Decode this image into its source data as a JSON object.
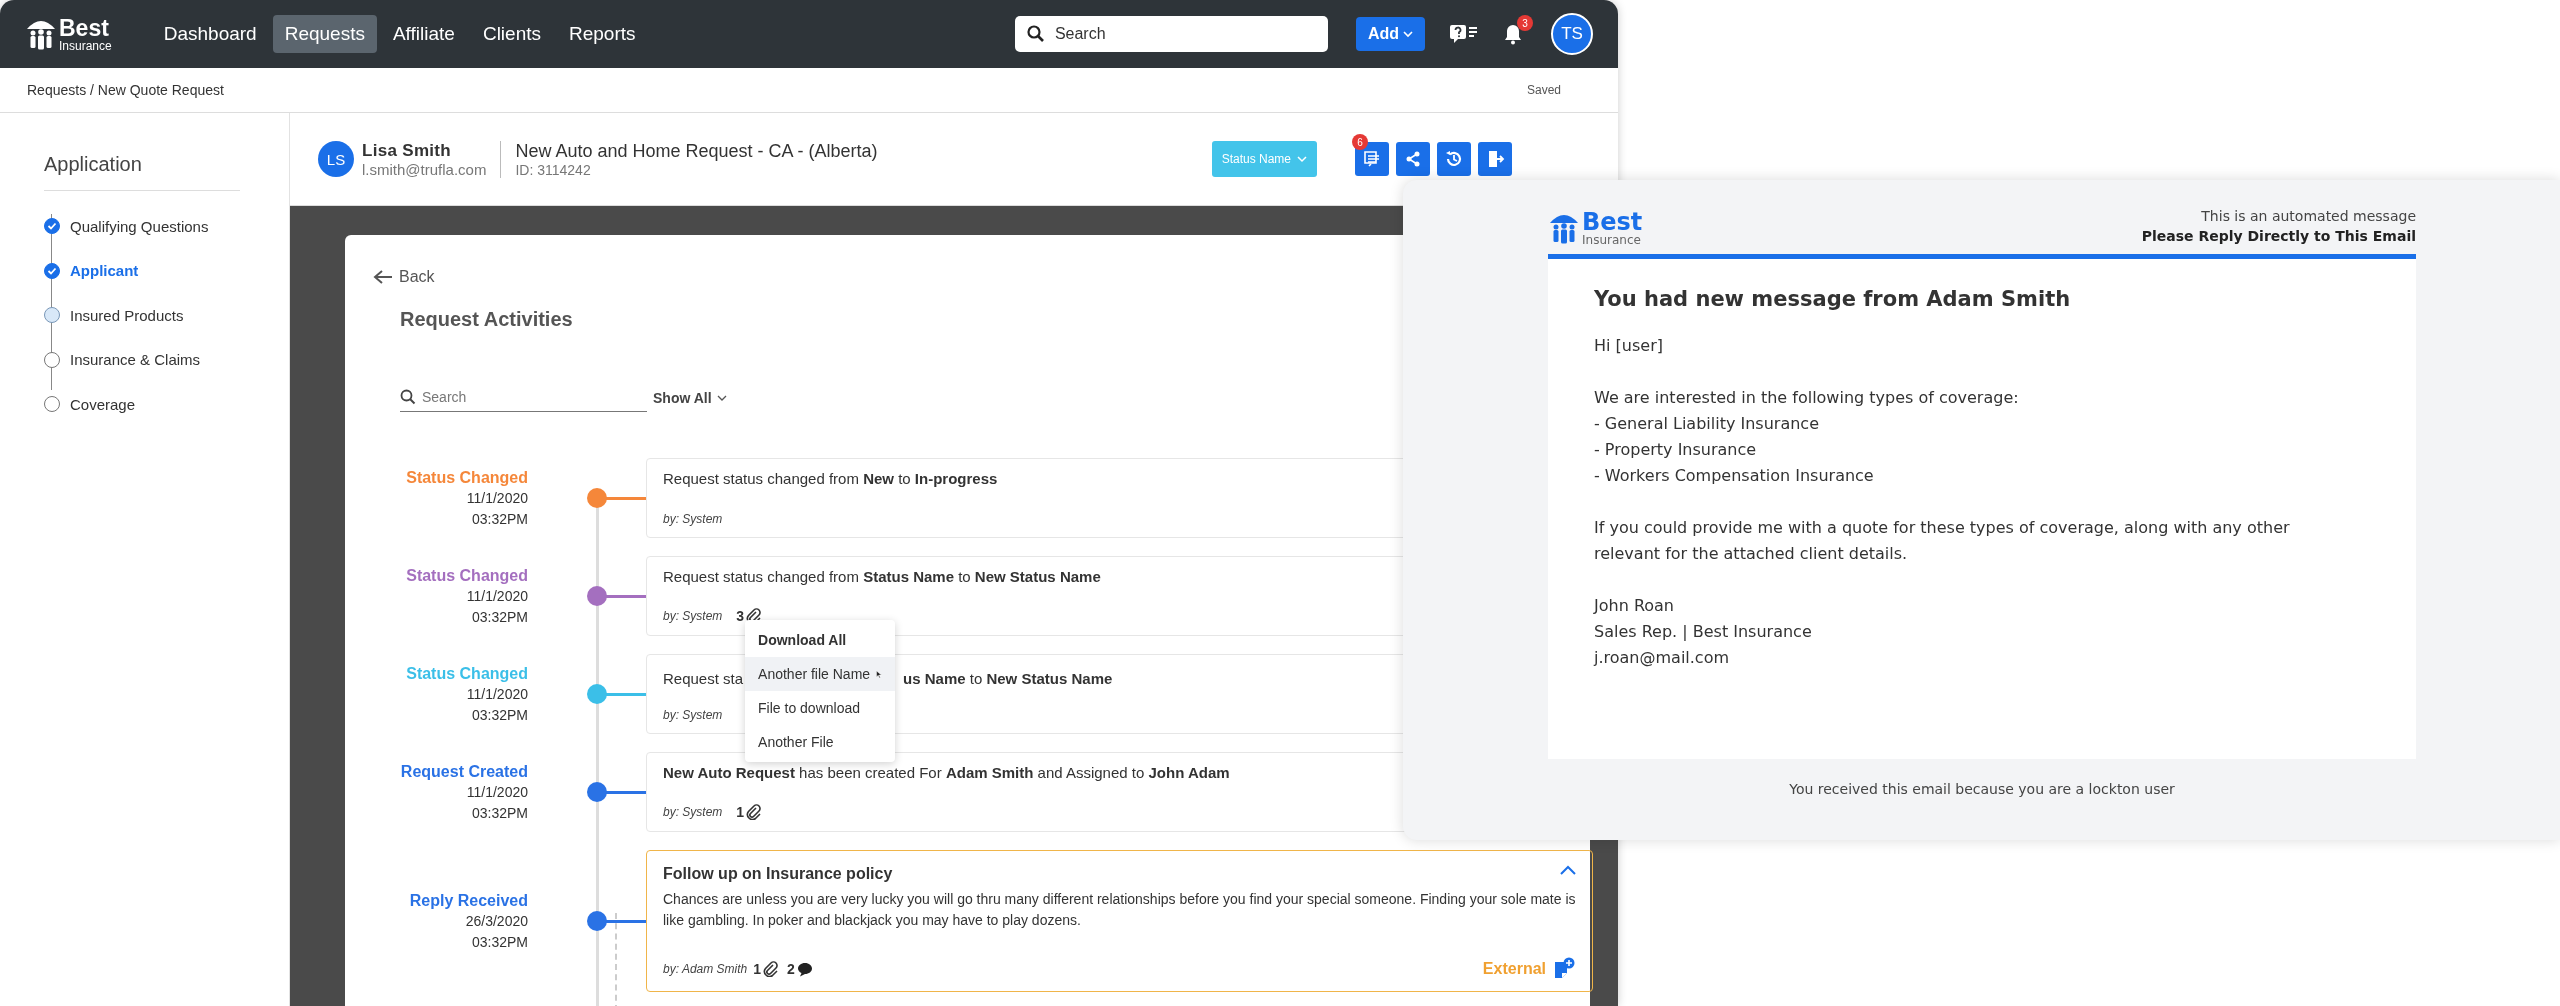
{
  "nav": {
    "logo": {
      "name": "Best",
      "sub": "Insurance"
    },
    "items": [
      {
        "label": "Dashboard",
        "selected": false
      },
      {
        "label": "Requests",
        "selected": true
      },
      {
        "label": "Affiliate",
        "selected": false
      },
      {
        "label": "Clients",
        "selected": false
      },
      {
        "label": "Reports",
        "selected": false
      }
    ],
    "search": {
      "placeholder": "Search"
    },
    "add_button": "Add",
    "notifications": "3",
    "avatar": "TS"
  },
  "breadcrumb": "Requests / New Quote Request",
  "save_status": "Saved",
  "sidebar": {
    "title": "Application",
    "steps": [
      {
        "label": "Qualifying Questions",
        "checked": true,
        "selected": false
      },
      {
        "label": "Applicant",
        "checked": true,
        "selected": true
      },
      {
        "label": "Insured Products",
        "checked": false,
        "selected": false,
        "visited": true
      },
      {
        "label": "Insurance & Claims",
        "checked": false,
        "selected": false,
        "visited": false
      },
      {
        "label": "Coverage",
        "checked": false,
        "selected": false,
        "visited": false
      }
    ]
  },
  "request": {
    "avatar": "LS",
    "name": "Lisa Smith",
    "email": "l.smith@trufla.com",
    "title": "New Auto and Home Request - CA - (Alberta)",
    "id": "ID: 3114242",
    "status": "Status Name",
    "actions_badge": "6"
  },
  "activities": {
    "back": "Back",
    "title": "Request Activities",
    "search": {
      "placeholder": "Search"
    },
    "filter": "Show All",
    "items": [
      {
        "kind": "event",
        "label": "Status Changed",
        "color": "#f5873a",
        "date": "11/1/2020",
        "time": "03:32PM",
        "text": "Request status changed from **New** to **In-progress**",
        "by": "by: System"
      },
      {
        "kind": "event",
        "label": "Status Changed",
        "color": "#a46fbf",
        "date": "11/1/2020",
        "time": "03:32PM",
        "text": "Request status changed from **Status Name** to **New Status Name**",
        "by": "by: System",
        "attachments": "3"
      },
      {
        "kind": "event",
        "label": "Status Changed",
        "color": "#3bbfe8",
        "date": "11/1/2020",
        "time": "03:32PM",
        "text": "Request sta",
        "text_after": "**us Name** to **New Status Name**",
        "by": "by: System"
      },
      {
        "kind": "event",
        "label": "Request Created",
        "color": "#2a72e5",
        "date": "11/1/2020",
        "time": "03:32PM",
        "text": "**New Auto Request** has been created For **Adam Smith** and Assigned to **John Adam**",
        "by": "by: System",
        "attachments": "1"
      },
      {
        "kind": "reply",
        "label": "Reply Received",
        "color": "#2a72e5",
        "date": "26/3/2020",
        "time": "03:32PM",
        "title": "Follow up on Insurance policy",
        "text": "Chances are unless you are very lucky you will go thru many different relationships before you find your special someone. Finding your sole mate is like gambling. In poker and blackjack you may have to play dozens.",
        "by": "by: Adam Smith",
        "attachments": "1",
        "comments": "2",
        "tag": "External",
        "expanded": true
      }
    ]
  },
  "attachment_menu": {
    "items": [
      {
        "label": "Download All",
        "kind": "header",
        "selected": false
      },
      {
        "label": "Another file Name",
        "kind": "file",
        "selected": true
      },
      {
        "label": "File to download",
        "kind": "file",
        "selected": false
      },
      {
        "label": "Another File",
        "kind": "file",
        "selected": false
      }
    ]
  },
  "email": {
    "logo": {
      "name": "Best",
      "sub": "Insurance"
    },
    "note": "This is an automated message",
    "note_bold": "Please Reply Directly to This Email",
    "title": "You had new message from Adam Smith",
    "paragraphs": [
      [
        "Hi [user]"
      ],
      [
        "We are interested in the following types of coverage:",
        "- General Liability Insurance",
        "- Property Insurance",
        "- Workers Compensation Insurance"
      ],
      [
        "If you could provide me with a quote for these types of coverage, along with any other",
        "relevant for the attached client details."
      ],
      [
        "John Roan",
        "Sales Rep. | Best Insurance",
        "j.roan@mail.com"
      ]
    ],
    "footer": "You received this email because you are a lockton user"
  }
}
